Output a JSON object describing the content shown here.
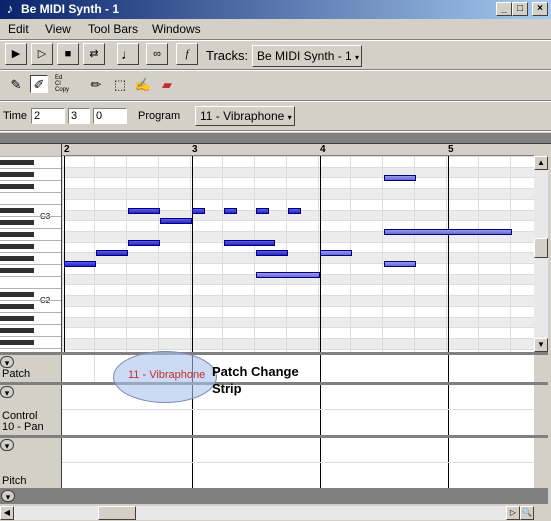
{
  "window": {
    "title": "Be MIDI Synth - 1",
    "app_icon": "music-note-icon",
    "controls": [
      "minimize-icon",
      "maximize-icon",
      "close-icon"
    ]
  },
  "menu": {
    "items": [
      "Edit",
      "View",
      "Tool Bars",
      "Windows"
    ]
  },
  "toolbar": {
    "transport": [
      {
        "name": "play-icon",
        "glyph": "▶"
      },
      {
        "name": "play-from-start-icon",
        "glyph": "▷"
      },
      {
        "name": "stop-icon",
        "glyph": "■"
      },
      {
        "name": "loop-icon",
        "glyph": "⇄"
      }
    ],
    "tracks_label": "Tracks:",
    "tracks_value": "Be MIDI Synth - 1"
  },
  "tools": [
    "pencil-tool-icon",
    "eraser-pencil-icon",
    "select-box-icon",
    "highlighter-icon",
    "eraser-icon"
  ],
  "position": {
    "time_label": "Time",
    "time": [
      "2",
      "3",
      "0"
    ],
    "program_label": "Program",
    "program_value": "11 - Vibraphone"
  },
  "ruler": {
    "marks": [
      "2",
      "3",
      "4",
      "5"
    ]
  },
  "piano": {
    "labels": [
      "C3",
      "C2"
    ]
  },
  "notes": [
    {
      "start": 0.0,
      "len": 0.25,
      "row": 10
    },
    {
      "start": 0.25,
      "len": 0.25,
      "row": 9
    },
    {
      "start": 0.5,
      "len": 0.25,
      "row": 5
    },
    {
      "start": 0.5,
      "len": 0.25,
      "row": 8
    },
    {
      "start": 0.75,
      "len": 0.25,
      "row": 6
    },
    {
      "start": 1.0,
      "len": 0.1,
      "row": 5
    },
    {
      "start": 1.25,
      "len": 0.1,
      "row": 5
    },
    {
      "start": 1.25,
      "len": 0.4,
      "row": 8
    },
    {
      "start": 1.5,
      "len": 0.1,
      "row": 5
    },
    {
      "start": 1.5,
      "len": 0.25,
      "row": 9
    },
    {
      "start": 1.5,
      "len": 0.5,
      "row": 11
    },
    {
      "start": 1.75,
      "len": 0.1,
      "row": 5
    },
    {
      "start": 2.0,
      "len": 0.25,
      "row": 9
    },
    {
      "start": 2.5,
      "len": 0.25,
      "row": 2
    },
    {
      "start": 2.5,
      "len": 1.0,
      "row": 7
    },
    {
      "start": 2.5,
      "len": 0.25,
      "row": 10
    }
  ],
  "strips": [
    {
      "label": "Patch"
    },
    {
      "label": "Control 10 - Pan"
    },
    {
      "label": "Pitch"
    }
  ],
  "patch_event": "11 - Vibraphone",
  "annotation": "Patch Change Strip",
  "colors": {
    "note": "#2828c8",
    "note_light": "#6a6ad8",
    "titlebar": "#0a246a"
  }
}
